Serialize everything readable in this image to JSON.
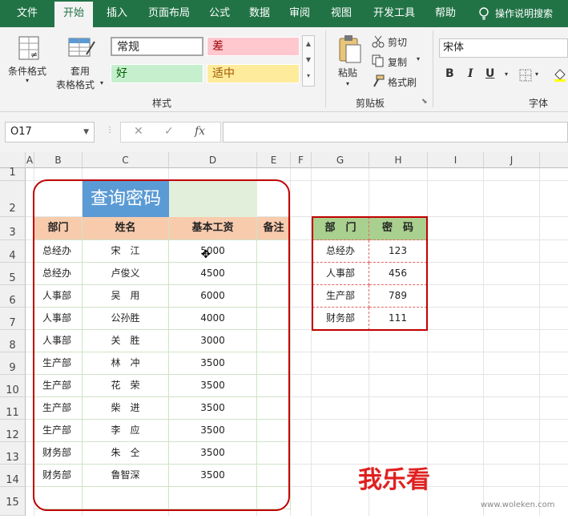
{
  "ribbon": {
    "tabs": [
      "文件",
      "开始",
      "插入",
      "页面布局",
      "公式",
      "数据",
      "审阅",
      "视图",
      "开发工具",
      "帮助"
    ],
    "active_tab": "开始",
    "tell_me": "操作说明搜索",
    "conditional_format": "条件格式",
    "table_format_1": "套用",
    "table_format_2": "表格格式",
    "styles": {
      "normal": "常规",
      "bad": "差",
      "good": "好",
      "neutral": "适中",
      "group_label": "样式"
    },
    "clipboard": {
      "paste": "粘贴",
      "cut": "剪切",
      "copy": "复制",
      "format_painter": "格式刷",
      "group_label": "剪贴板"
    },
    "font": {
      "name": "宋体",
      "bold": "B",
      "italic": "I",
      "underline": "U",
      "group_label": "字体"
    }
  },
  "formula_bar": {
    "name_box": "O17",
    "fx": "fx",
    "cancel": "✕",
    "enter": "✓",
    "value": ""
  },
  "columns": [
    "A",
    "B",
    "C",
    "D",
    "E",
    "F",
    "G",
    "H",
    "I",
    "J"
  ],
  "rows": [
    "1",
    "2",
    "3",
    "4",
    "5",
    "6",
    "7",
    "8",
    "9",
    "10",
    "11",
    "12",
    "13",
    "14",
    "15"
  ],
  "table1": {
    "title": "查询密码",
    "headers": [
      "部门",
      "姓名",
      "基本工资",
      "备注"
    ],
    "rows": [
      [
        "总经办",
        "宋　江",
        "5000",
        ""
      ],
      [
        "总经办",
        "卢俊义",
        "4500",
        ""
      ],
      [
        "人事部",
        "吴　用",
        "6000",
        ""
      ],
      [
        "人事部",
        "公孙胜",
        "4000",
        ""
      ],
      [
        "人事部",
        "关　胜",
        "3000",
        ""
      ],
      [
        "生产部",
        "林　冲",
        "3500",
        ""
      ],
      [
        "生产部",
        "花　荣",
        "3500",
        ""
      ],
      [
        "生产部",
        "柴　进",
        "3500",
        ""
      ],
      [
        "生产部",
        "李　应",
        "3500",
        ""
      ],
      [
        "财务部",
        "朱　仝",
        "3500",
        ""
      ],
      [
        "财务部",
        "鲁智深",
        "3500",
        ""
      ]
    ]
  },
  "table2": {
    "headers": [
      "部　门",
      "密　码"
    ],
    "rows": [
      [
        "总经办",
        "123"
      ],
      [
        "人事部",
        "456"
      ],
      [
        "生产部",
        "789"
      ],
      [
        "财务部",
        "111"
      ]
    ]
  },
  "watermark": {
    "text": "我乐看",
    "sub": "www.woleken.com"
  },
  "colors": {
    "ribbon": "#217346",
    "title_bg": "#5b9bd5",
    "header_bg": "#f8cbad",
    "table2_header": "#a9d08e",
    "outline": "#c00000"
  }
}
